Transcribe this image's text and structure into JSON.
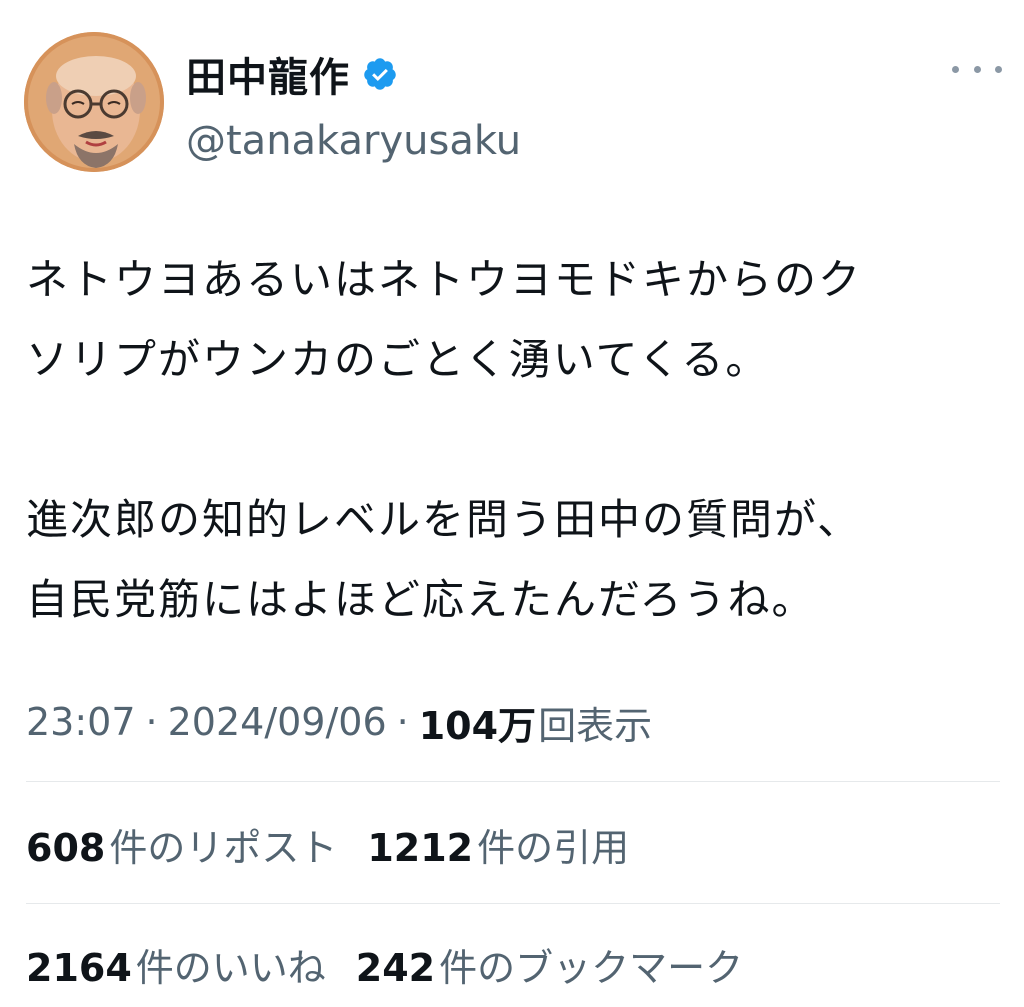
{
  "user": {
    "display_name": "田中龍作",
    "handle": "@tanakaryusaku",
    "verified_badge_icon": "verified-badge-icon",
    "verified_color": "#1d9bf0"
  },
  "tweet": {
    "paragraphs": [
      [
        "ネトウヨあるいはネトウヨモドキからのク",
        "ソリプがウンカのごとく湧いてくる。"
      ],
      [
        "進次郎の知的レベルを問う田中の質問が、",
        "自民党筋にはよほど応えたんだろうね。"
      ]
    ]
  },
  "meta": {
    "time": "23:07",
    "separator": "·",
    "date": "2024/09/06",
    "views_count": "104万",
    "views_label": "回表示"
  },
  "stats": {
    "reposts": {
      "count": "608",
      "label": "件のリポスト"
    },
    "quotes": {
      "count": "1212",
      "label": "件の引用"
    },
    "likes": {
      "count": "2164",
      "label": "件のいいね"
    },
    "bookmarks": {
      "count": "242",
      "label": "件のブックマーク"
    }
  },
  "colors": {
    "text_primary": "#0f1419",
    "text_secondary": "#536471",
    "divider": "#e6e9eb",
    "accent": "#1d9bf0"
  }
}
